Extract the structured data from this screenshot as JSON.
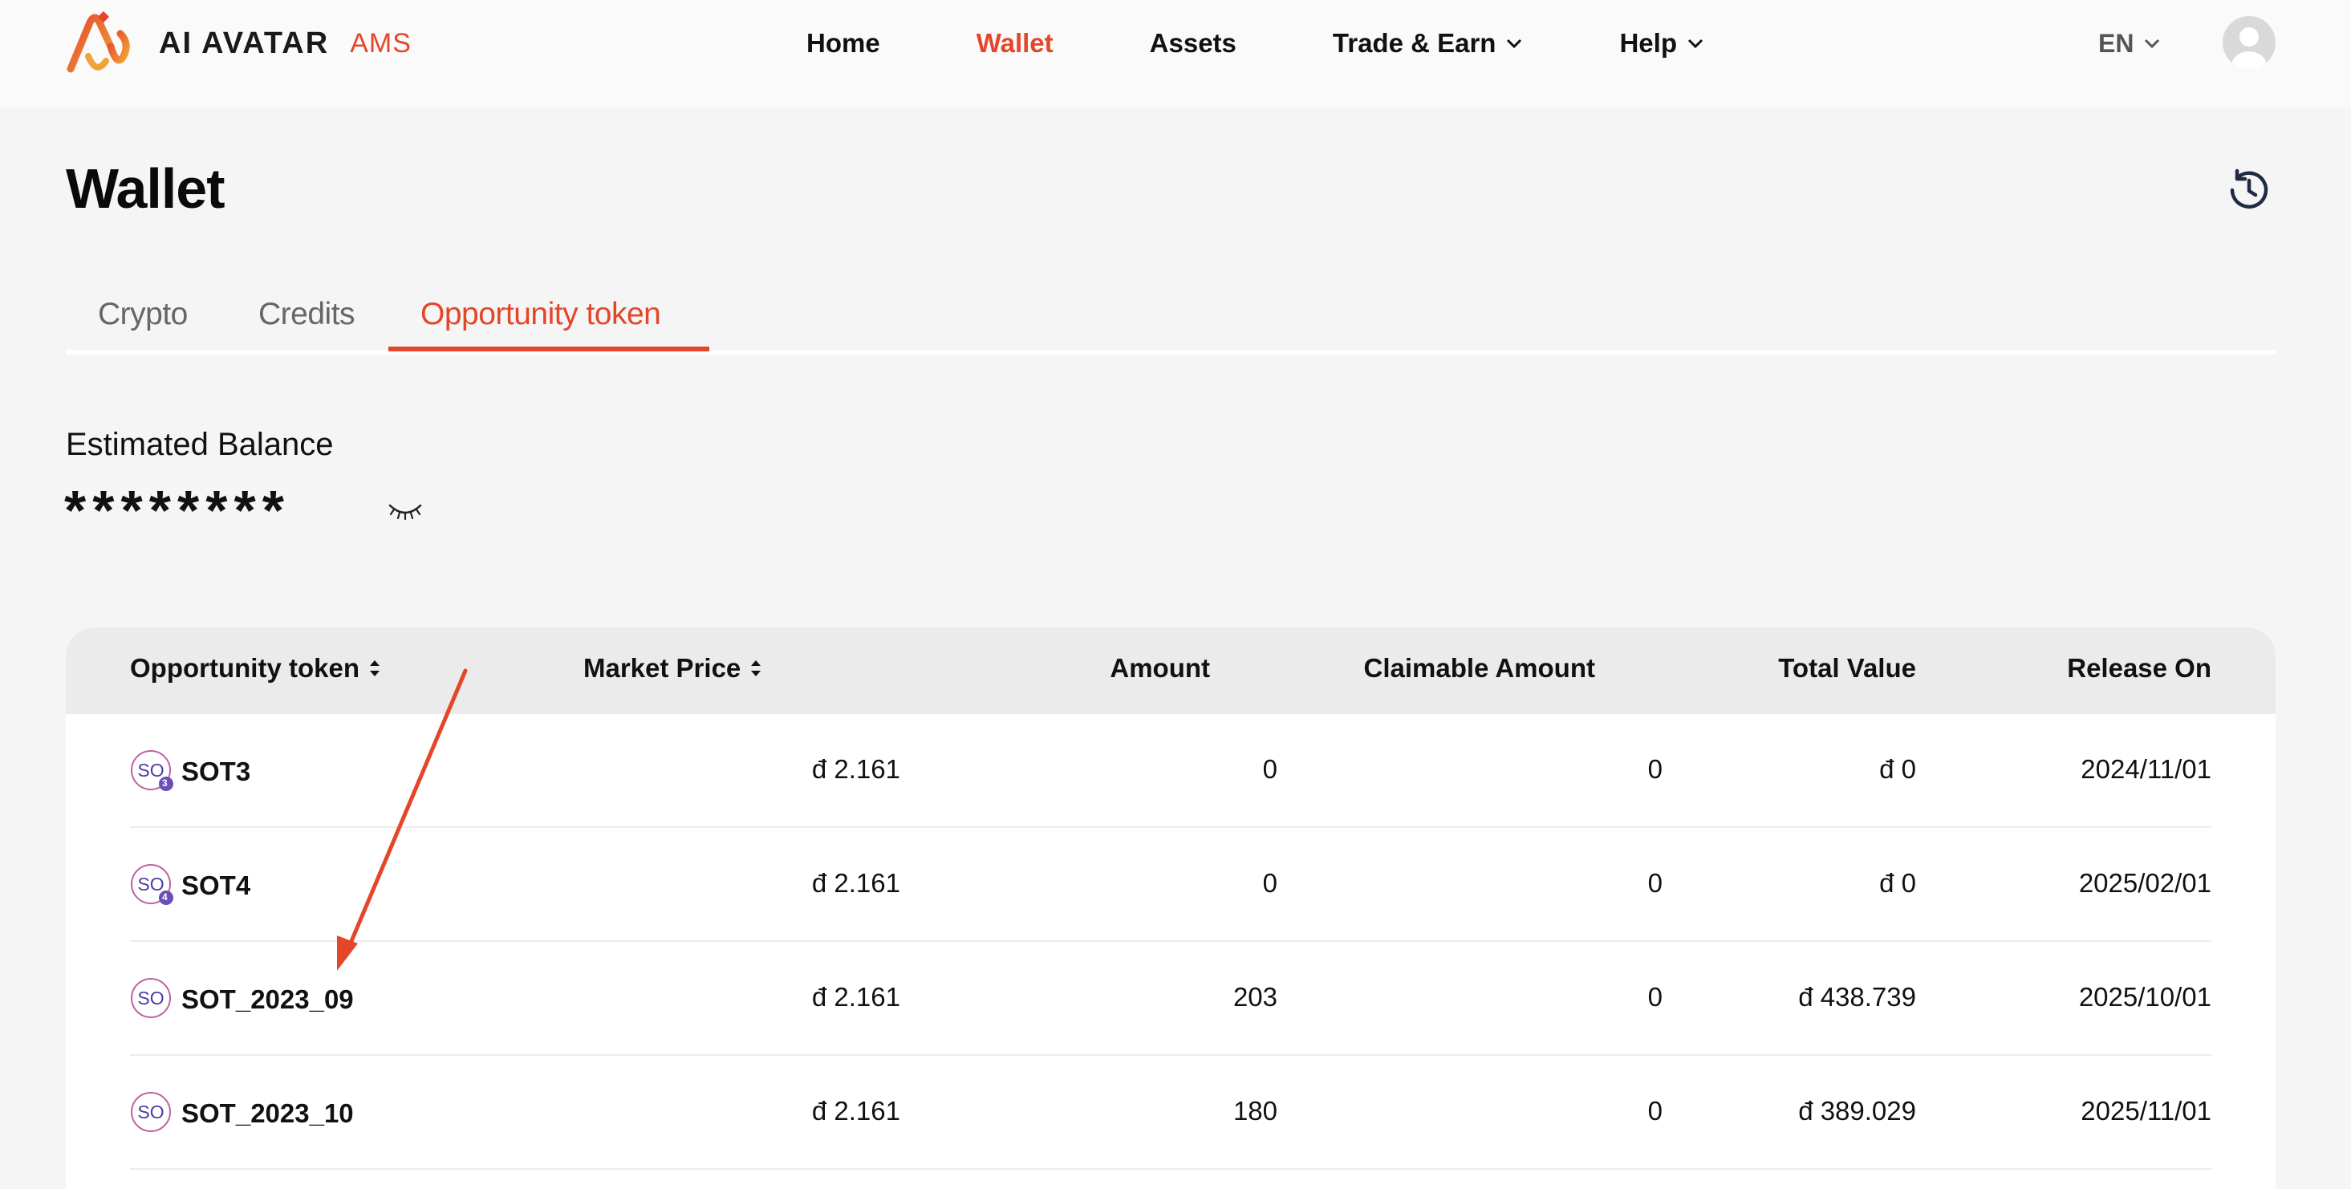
{
  "brand": {
    "name": "AI AVATAR",
    "sub": "AMS",
    "accent": "#e4462a"
  },
  "nav": [
    {
      "label": "Home"
    },
    {
      "label": "Wallet",
      "active": true
    },
    {
      "label": "Assets"
    },
    {
      "label": "Trade & Earn",
      "dropdown": true
    },
    {
      "label": "Help",
      "dropdown": true
    }
  ],
  "lang": "EN",
  "page": {
    "title": "Wallet"
  },
  "tabs": [
    {
      "label": "Crypto"
    },
    {
      "label": "Credits"
    },
    {
      "label": "Opportunity token",
      "active": true
    }
  ],
  "balance": {
    "label": "Estimated Balance",
    "value": "********"
  },
  "table": {
    "headers": [
      "Opportunity token",
      "Market Price",
      "Amount",
      "Claimable Amount",
      "Total Value",
      "Release On"
    ],
    "rows": [
      {
        "token": "SOT3",
        "badge": "3",
        "price": "đ 2.161",
        "amount": "0",
        "claimable": "0",
        "total": "đ 0",
        "release": "2024/11/01"
      },
      {
        "token": "SOT4",
        "badge": "4",
        "price": "đ 2.161",
        "amount": "0",
        "claimable": "0",
        "total": "đ 0",
        "release": "2025/02/01"
      },
      {
        "token": "SOT_2023_09",
        "badge": "",
        "price": "đ 2.161",
        "amount": "203",
        "claimable": "0",
        "total": "đ 438.739",
        "release": "2025/10/01"
      },
      {
        "token": "SOT_2023_10",
        "badge": "",
        "price": "đ 2.161",
        "amount": "180",
        "claimable": "0",
        "total": "đ 389.029",
        "release": "2025/11/01"
      }
    ]
  },
  "icons": {
    "logo": "ai-avatar-logo",
    "history": "history-clock-icon",
    "eye": "eye-closed-icon",
    "sort": "sort-icon",
    "chevron": "chevron-down-icon"
  }
}
